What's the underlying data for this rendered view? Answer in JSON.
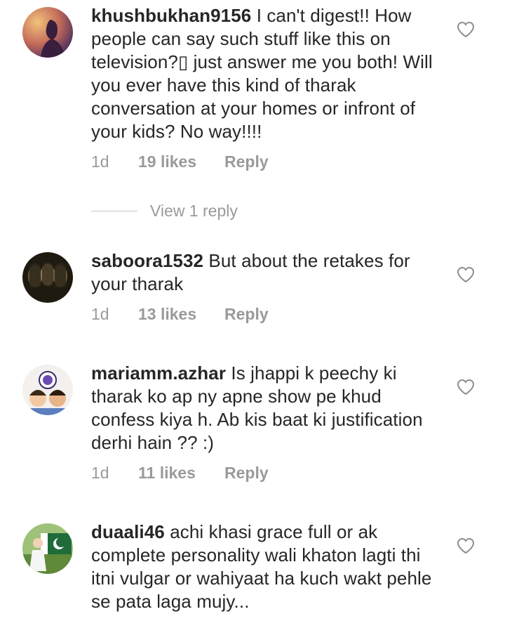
{
  "comments": [
    {
      "username": "khushbukhan9156",
      "text": "I can't digest!! How people can say such stuff like this on television?▯ just answer me you both! Will you ever have this kind of  tharak conversation at your homes or infront of your kids? No way!!!!",
      "time": "1d",
      "likes": "19 likes",
      "reply": "Reply"
    },
    {
      "username": "saboora1532",
      "text": "But about the retakes for your tharak",
      "time": "1d",
      "likes": "13 likes",
      "reply": "Reply"
    },
    {
      "username": "mariamm.azhar",
      "text": "Is jhappi k peechy ki tharak ko ap ny apne show pe khud confess kiya h. Ab kis baat ki justification derhi hain ?? :)",
      "time": "1d",
      "likes": "11 likes",
      "reply": "Reply"
    },
    {
      "username": "duaali46",
      "text": "achi khasi grace full or ak complete personality wali khaton lagti thi itni vulgar or wahiyaat ha kuch wakt pehle se pata laga mujy...",
      "time": "",
      "likes": "",
      "reply": ""
    }
  ],
  "view_replies": "View 1 reply",
  "icons": {
    "like": "heart-outline-icon"
  },
  "colors": {
    "text": "#262626",
    "secondary": "#9a9a9a"
  }
}
